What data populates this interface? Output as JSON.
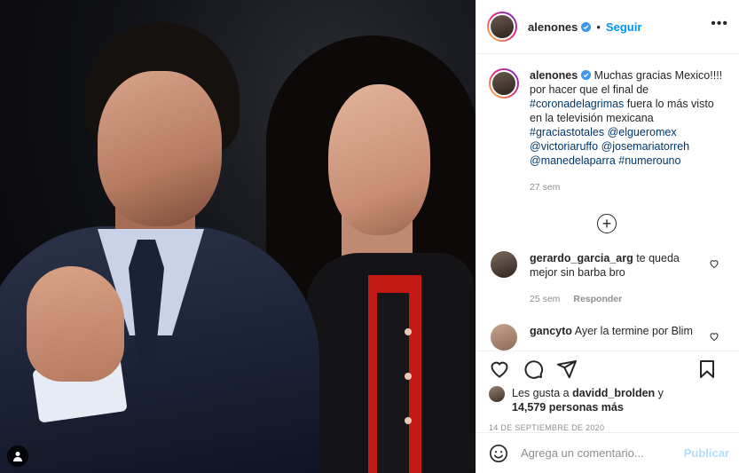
{
  "post": {
    "username": "alenones",
    "follow_label": "Seguir",
    "separator": "•",
    "verified_icon": "verified-badge-icon"
  },
  "caption": {
    "username": "alenones",
    "text_before": " Muchas gracias Mexico!!!! por hacer que el final de ",
    "tag1": "#coronadelagrimas",
    "text_after": " fuera lo más visto en la televisión mexicana ",
    "tags": [
      "#graciastotales",
      "@elgueromex",
      "@victoriaruffo",
      "@josemariatorreh",
      "@manedelaparra",
      "#numerouno"
    ],
    "time": "27 sem"
  },
  "comments": [
    {
      "username": "gerardo_garcia_arg",
      "text": " te queda mejor sin barba bro",
      "time": "25 sem",
      "reply_label": "Responder"
    },
    {
      "username": "gancyto",
      "text": " Ayer la termine por Blim"
    }
  ],
  "likes": {
    "prefix": "Les gusta a ",
    "user": "davidd_brolden",
    "middle": " y",
    "count": "14,579 personas más"
  },
  "date": "14 DE SEPTIEMBRE DE 2020",
  "composer": {
    "placeholder": "Agrega un comentario...",
    "publish_label": "Publicar"
  },
  "colors": {
    "accent": "#0095f6",
    "tag": "#00376b",
    "muted": "#8e8e8e",
    "publish_disabled": "#b2dffc"
  }
}
